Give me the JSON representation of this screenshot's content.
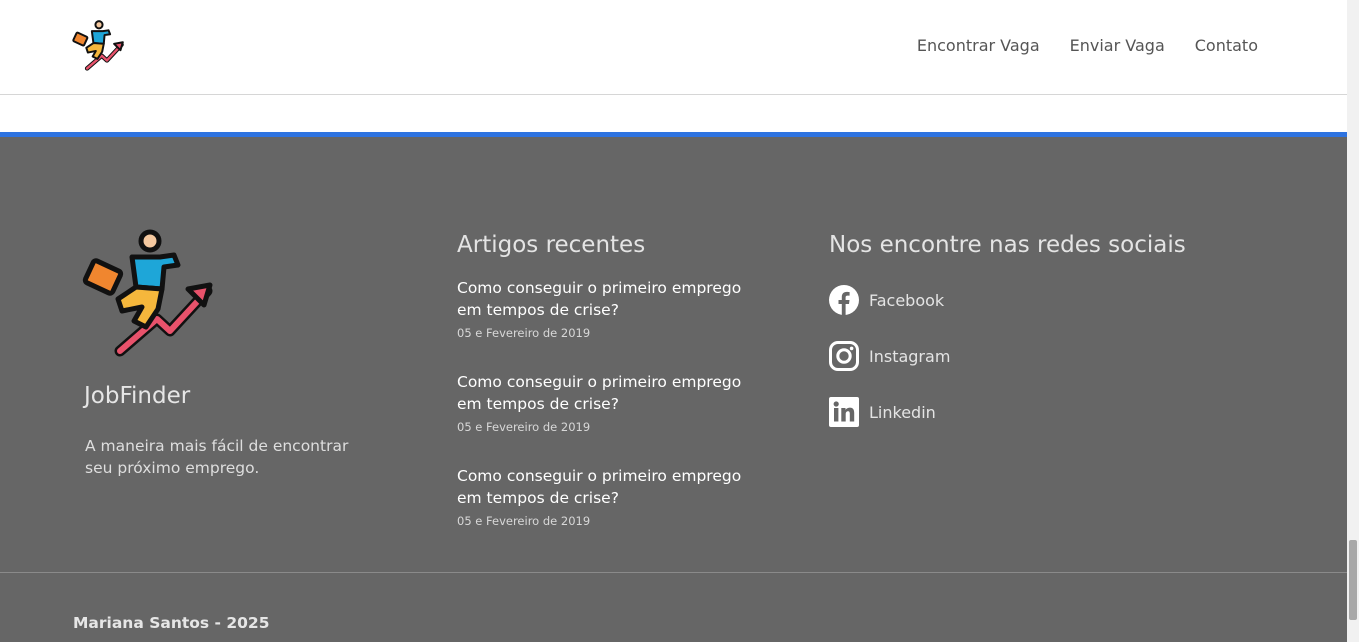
{
  "header": {
    "nav": [
      "Encontrar Vaga",
      "Enviar Vaga",
      "Contato"
    ]
  },
  "footer": {
    "brand": {
      "name": "JobFinder",
      "description": "A maneira mais fácil de encontrar seu próximo emprego."
    },
    "articles": {
      "title": "Artigos recentes",
      "items": [
        {
          "title": "Como conseguir o primeiro emprego em tempos de crise?",
          "date": "05 e Fevereiro de 2019"
        },
        {
          "title": "Como conseguir o primeiro emprego em tempos de crise?",
          "date": "05 e Fevereiro de 2019"
        },
        {
          "title": "Como conseguir o primeiro emprego em tempos de crise?",
          "date": "05 e Fevereiro de 2019"
        }
      ]
    },
    "social": {
      "title": "Nos encontre nas redes sociais",
      "items": [
        {
          "label": "Facebook",
          "icon": "facebook-icon"
        },
        {
          "label": "Instagram",
          "icon": "instagram-icon"
        },
        {
          "label": "Linkedin",
          "icon": "linkedin-icon"
        }
      ]
    },
    "copyright": "Mariana Santos - 2025"
  },
  "colors": {
    "accent": "#2e73e0",
    "footer_bg": "#666666",
    "header_bg": "#ffffff",
    "arrow": "#e8526b",
    "shirt": "#1ea6d8",
    "pants": "#f5b73c",
    "briefcase": "#f0862f"
  }
}
